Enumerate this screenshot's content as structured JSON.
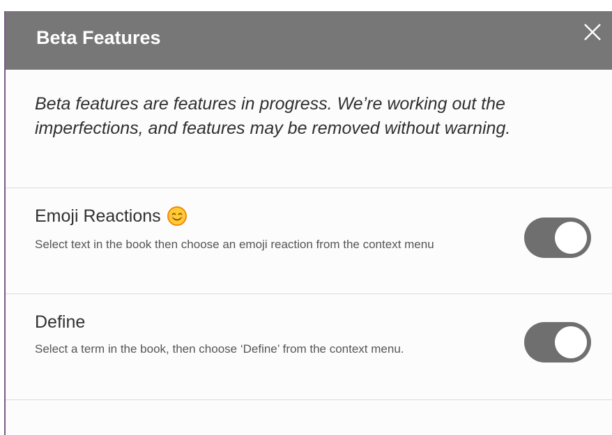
{
  "dialog": {
    "title": "Beta Features",
    "close_icon": "close-icon"
  },
  "intro": {
    "text": "Beta features are features in progress. We’re working out the imperfections, and features may be removed without warning."
  },
  "features": [
    {
      "title": "Emoji Reactions",
      "icon": "smiling-face-emoji-icon",
      "description": "Select text in the book then choose an emoji reaction from the context menu",
      "enabled": true
    },
    {
      "title": "Define",
      "description": "Select a term in the book, then choose ‘Define’ from the context menu.",
      "enabled": true
    }
  ],
  "colors": {
    "header_bg": "#777777",
    "toggle_on": "#6f6f6f",
    "emoji_face": "#ffcc33",
    "emoji_outline": "#f08a0a",
    "left_border": "#7a5a86"
  }
}
